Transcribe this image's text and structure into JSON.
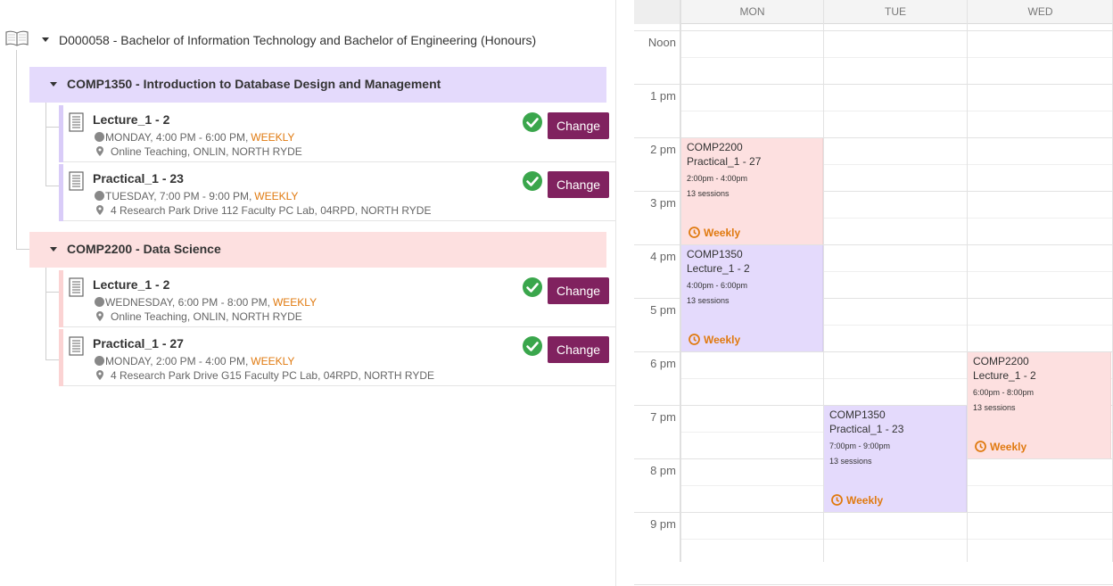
{
  "degree": {
    "title": "D000058 - Bachelor of Information Technology and Bachelor of Engineering (Honours)"
  },
  "courses": [
    {
      "title": "COMP1350 - Introduction to Database Design and Management",
      "color": "#e4dafc",
      "bar_color": "#d9ccf8",
      "activities": [
        {
          "name": "Lecture_1 - 2",
          "time": "MONDAY, 4:00 PM - 6:00 PM,",
          "frequency": "WEEKLY",
          "location": "Online Teaching, ONLIN, NORTH RYDE",
          "button": "Change"
        },
        {
          "name": "Practical_1 - 23",
          "time": "TUESDAY, 7:00 PM - 9:00 PM,",
          "frequency": "WEEKLY",
          "location": "4 Research Park Drive 112 Faculty PC Lab, 04RPD, NORTH RYDE",
          "button": "Change"
        }
      ]
    },
    {
      "title": "COMP2200 - Data Science",
      "color": "#fde0e0",
      "bar_color": "#fbd3d3",
      "activities": [
        {
          "name": "Lecture_1 - 2",
          "time": "WEDNESDAY, 6:00 PM - 8:00 PM,",
          "frequency": "WEEKLY",
          "location": "Online Teaching, ONLIN, NORTH RYDE",
          "button": "Change"
        },
        {
          "name": "Practical_1 - 27",
          "time": "MONDAY, 2:00 PM - 4:00 PM,",
          "frequency": "WEEKLY",
          "location": "4 Research Park Drive G15 Faculty PC Lab, 04RPD, NORTH RYDE",
          "button": "Change"
        }
      ]
    }
  ],
  "calendar": {
    "days": [
      "MON",
      "TUE",
      "WED"
    ],
    "times": [
      "Noon",
      "1 pm",
      "2 pm",
      "3 pm",
      "4 pm",
      "5 pm",
      "6 pm",
      "7 pm",
      "8 pm",
      "9 pm"
    ],
    "events": [
      {
        "code": "COMP2200",
        "name": "Practical_1 - 27",
        "time": "2:00pm - 4:00pm",
        "sessions": "13 sessions",
        "frequency": "Weekly",
        "color": "#fde0e0"
      },
      {
        "code": "COMP1350",
        "name": "Lecture_1 - 2",
        "time": "4:00pm - 6:00pm",
        "sessions": "13 sessions",
        "frequency": "Weekly",
        "color": "#e4dafc"
      },
      {
        "code": "COMP1350",
        "name": "Practical_1 - 23",
        "time": "7:00pm - 9:00pm",
        "sessions": "13 sessions",
        "frequency": "Weekly",
        "color": "#e4dafc"
      },
      {
        "code": "COMP2200",
        "name": "Lecture_1 - 2",
        "time": "6:00pm - 8:00pm",
        "sessions": "13 sessions",
        "frequency": "Weekly",
        "color": "#fde0e0"
      }
    ]
  },
  "colors": {
    "accent_button": "#80225f",
    "weekly": "#e07a10",
    "check": "#3aa64c"
  }
}
